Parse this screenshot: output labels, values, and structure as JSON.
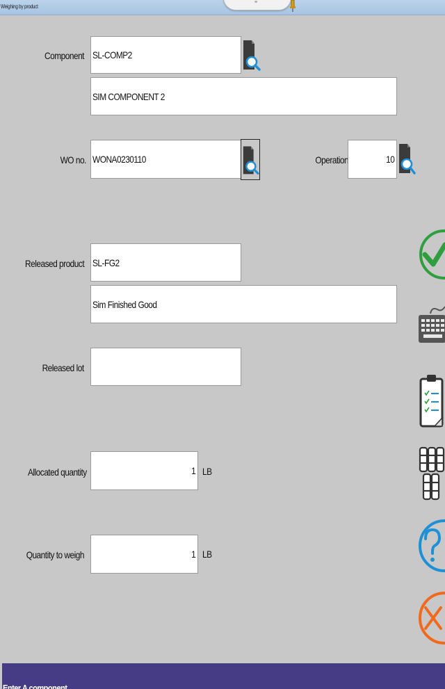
{
  "window": {
    "title": "Weighing by product"
  },
  "component": {
    "label": "Component",
    "code": "SL-COMP2",
    "description": "SIM COMPONENT 2"
  },
  "work_order": {
    "label": "WO no.",
    "value": "WONA0230110"
  },
  "operation": {
    "label": "Operation",
    "value": "10"
  },
  "released_product": {
    "label": "Released product",
    "code": "SL-FG2",
    "description": "Sim Finished Good"
  },
  "released_lot": {
    "label": "Released lot",
    "value": ""
  },
  "allocated_quantity": {
    "label": "Allocated quantity",
    "value": "1",
    "unit": "LB"
  },
  "quantity_to_weigh": {
    "label": "Quantity to weigh",
    "value": "1",
    "unit": "LB"
  },
  "side_actions": [
    {
      "icon": "checkmark-circle-icon",
      "color": "#2e9e3e"
    },
    {
      "icon": "keyboard-icon",
      "color": "#5a5a5a"
    },
    {
      "icon": "clipboard-checklist-icon",
      "color": "#3a3a3a"
    },
    {
      "icon": "drums-icon",
      "color": "#3a3a3a"
    },
    {
      "icon": "help-icon",
      "color": "#1e90d6"
    },
    {
      "icon": "cancel-icon",
      "color": "#f06a1e"
    }
  ],
  "status": {
    "message": "Enter A component"
  },
  "colors": {
    "background": "#c8c8c8",
    "statusbar": "#463c86",
    "lookup_accent": "#1e90d6"
  }
}
